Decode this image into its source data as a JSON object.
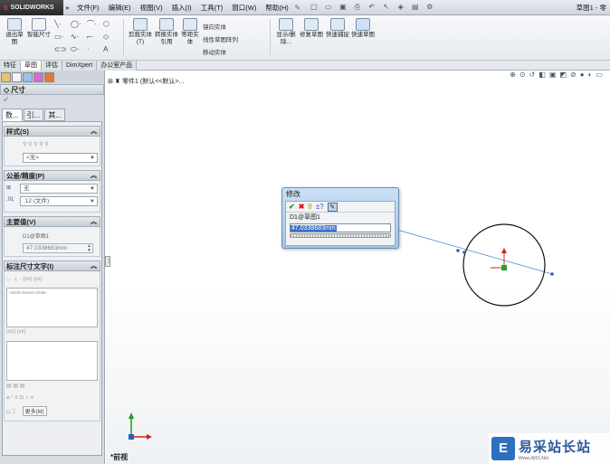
{
  "app": {
    "logo_text": "SOLIDWORKS",
    "window_title": "草图1 - 零"
  },
  "menu": [
    "文件(F)",
    "编辑(E)",
    "视图(V)",
    "插入(I)",
    "工具(T)",
    "窗口(W)",
    "帮助(H)"
  ],
  "ribbon": {
    "exit_sketch": "退出草图",
    "smart_dim": "智能尺寸",
    "trim": "剪裁实体(T)",
    "convert": "转换实体引用",
    "offset": "等距实体",
    "mirror": "镜向实体",
    "linear_array": "线性草图阵列",
    "move": "移动实体",
    "display_delete": "显示/删除...",
    "repair": "修复草图",
    "quick_snap": "快速捕捉",
    "quick_sketch": "快速草图"
  },
  "tabs": [
    "特征",
    "草图",
    "评估",
    "DimXpert",
    "办公室产品"
  ],
  "tabs_active": 1,
  "panel": {
    "title": "尺寸",
    "ptabs": [
      "数...",
      "引...",
      "其..."
    ],
    "style": {
      "header": "样式(S)",
      "value": "<无>"
    },
    "tolerance": {
      "header": "公差/精度(P)",
      "tol_value": "无",
      "precision_value": ".12 (文件)"
    },
    "primary": {
      "header": "主要值(V)",
      "name": "D1@草图1",
      "value": "47.0338683mm"
    },
    "dimtext": {
      "header": "标注尺寸文字(I)",
      "content": "<MOD-DIAM><DIM>",
      "more": "更多(M)"
    }
  },
  "graphics": {
    "tree_item": "零件1 (默认<<默认>...",
    "view_label": "*前视"
  },
  "dialog": {
    "title": "修改",
    "dim_name": "D1@草图1",
    "value": "47.0338683mm"
  },
  "watermark": {
    "cn": "易采站长站",
    "url": "Www.Jb51.Net"
  },
  "colors": {
    "accent": "#3b72c7",
    "circle": "#111111",
    "dim_line": "#4a86d6"
  }
}
